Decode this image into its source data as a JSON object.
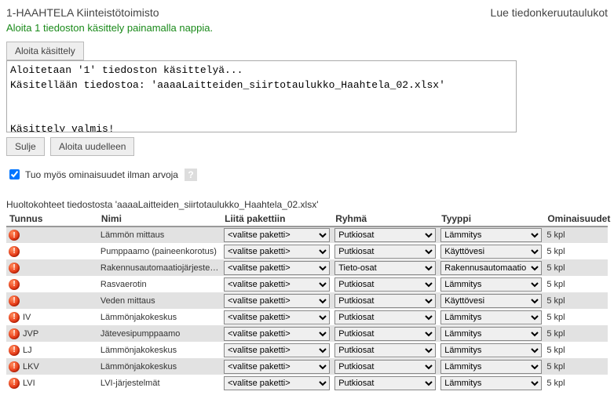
{
  "header": {
    "left": "1-HAAHTELA Kiinteistötoimisto",
    "right": "Lue tiedonkeruutaulukot"
  },
  "message": "Aloita 1 tiedoston käsittely painamalla nappia.",
  "buttons": {
    "start": "Aloita käsittely",
    "close": "Sulje",
    "restart": "Aloita uudelleen"
  },
  "log": "Aloitetaan '1' tiedoston käsittelyä...\nKäsitellään tiedostoa: 'aaaaLaitteiden_siirtotaulukko_Haahtela_02.xlsx'\n\n\nKäsittely valmis!",
  "checkbox": {
    "label": "Tuo myös ominaisuudet ilman arvoja",
    "checked": true
  },
  "help_icon": "?",
  "subhead": "Huoltokohteet tiedostosta 'aaaaLaitteiden_siirtotaulukko_Haahtela_02.xlsx'",
  "columns": {
    "tunnus": "Tunnus",
    "nimi": "Nimi",
    "paketti": "Liitä pakettiin",
    "ryhma": "Ryhmä",
    "tyyppi": "Tyyppi",
    "omin": "Ominaisuudet"
  },
  "options": {
    "paketti_placeholder": "<valitse paketti>"
  },
  "rows": [
    {
      "tunnus": "",
      "nimi": "Lämmön mittaus",
      "paketti": "<valitse paketti>",
      "ryhma": "Putkiosat",
      "tyyppi": "Lämmitys",
      "omin": "5 kpl"
    },
    {
      "tunnus": "",
      "nimi": "Pumppaamo (paineenkorotus)",
      "paketti": "<valitse paketti>",
      "ryhma": "Putkiosat",
      "tyyppi": "Käyttövesi",
      "omin": "5 kpl"
    },
    {
      "tunnus": "",
      "nimi": "Rakennusautomaatiojärjestelmä",
      "paketti": "<valitse paketti>",
      "ryhma": "Tieto-osat",
      "tyyppi": "Rakennusautomaatio",
      "omin": "5 kpl"
    },
    {
      "tunnus": "",
      "nimi": "Rasvaerotin",
      "paketti": "<valitse paketti>",
      "ryhma": "Putkiosat",
      "tyyppi": "Lämmitys",
      "omin": "5 kpl"
    },
    {
      "tunnus": "",
      "nimi": "Veden mittaus",
      "paketti": "<valitse paketti>",
      "ryhma": "Putkiosat",
      "tyyppi": "Käyttövesi",
      "omin": "5 kpl"
    },
    {
      "tunnus": "IV",
      "nimi": "Lämmönjakokeskus",
      "paketti": "<valitse paketti>",
      "ryhma": "Putkiosat",
      "tyyppi": "Lämmitys",
      "omin": "5 kpl"
    },
    {
      "tunnus": "JVP",
      "nimi": "Jätevesipumppaamo",
      "paketti": "<valitse paketti>",
      "ryhma": "Putkiosat",
      "tyyppi": "Lämmitys",
      "omin": "5 kpl"
    },
    {
      "tunnus": "LJ",
      "nimi": "Lämmönjakokeskus",
      "paketti": "<valitse paketti>",
      "ryhma": "Putkiosat",
      "tyyppi": "Lämmitys",
      "omin": "5 kpl"
    },
    {
      "tunnus": "LKV",
      "nimi": "Lämmönjakokeskus",
      "paketti": "<valitse paketti>",
      "ryhma": "Putkiosat",
      "tyyppi": "Lämmitys",
      "omin": "5 kpl"
    },
    {
      "tunnus": "LVI",
      "nimi": "LVI-järjestelmät",
      "paketti": "<valitse paketti>",
      "ryhma": "Putkiosat",
      "tyyppi": "Lämmitys",
      "omin": "5 kpl"
    }
  ]
}
